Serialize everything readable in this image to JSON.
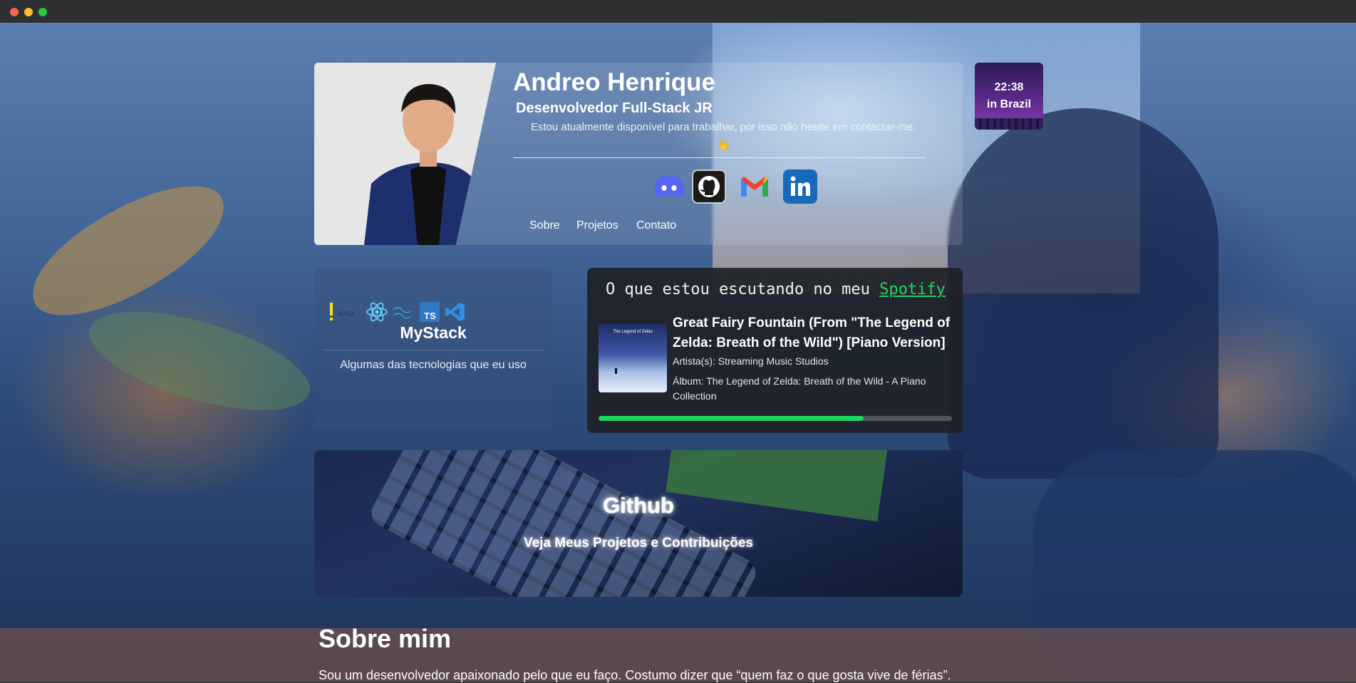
{
  "header": {
    "name": "Andreo Henrique",
    "role": "Desenvolvedor Full-Stack JR",
    "availability": "Estou atualmente disponível para trabalhar, por isso não hesite em contactar-me.",
    "wave_emoji": "👋",
    "socials": [
      {
        "name": "discord-icon",
        "color": "#5865f2"
      },
      {
        "name": "github-icon",
        "color": "#ffffff"
      },
      {
        "name": "gmail-icon",
        "color": "#ea4335"
      },
      {
        "name": "linkedin-icon",
        "color": "#1869b8"
      }
    ],
    "nav": [
      "Sobre",
      "Projetos",
      "Contato"
    ]
  },
  "clock": {
    "time": "22:38",
    "place": "in Brazil"
  },
  "stack": {
    "title": "MyStack",
    "subtitle": "Algumas das tecnologias que eu uso",
    "icons": [
      "javascript-icon",
      "mysql-icon",
      "react-icon",
      "tailwind-icon",
      "typescript-icon",
      "vscode-icon"
    ],
    "ts_label": "TS",
    "mysql_label": "MySQL"
  },
  "spotify": {
    "heading": "O que estou escutando no meu",
    "link": "Spotify",
    "song": "Great Fairy Fountain (From \"The Legend of Zelda: Breath of the Wild\") [Piano Version]",
    "artist": "Artista(s): Streaming Music Studios",
    "album": "Álbum: The Legend of Zelda: Breath of the Wild - A Piano Collection",
    "album_art_text": "The Legend of Zelda",
    "progress": 0.75,
    "accent": "#1ed760"
  },
  "github": {
    "title": "Github",
    "subtitle": "Veja Meus Projetos e Contribuições"
  },
  "about": {
    "title": "Sobre mim",
    "text": "Sou um desenvolvedor apaixonado pelo que eu faço. Costumo dizer que “quem faz o que gosta vive de férias”."
  }
}
